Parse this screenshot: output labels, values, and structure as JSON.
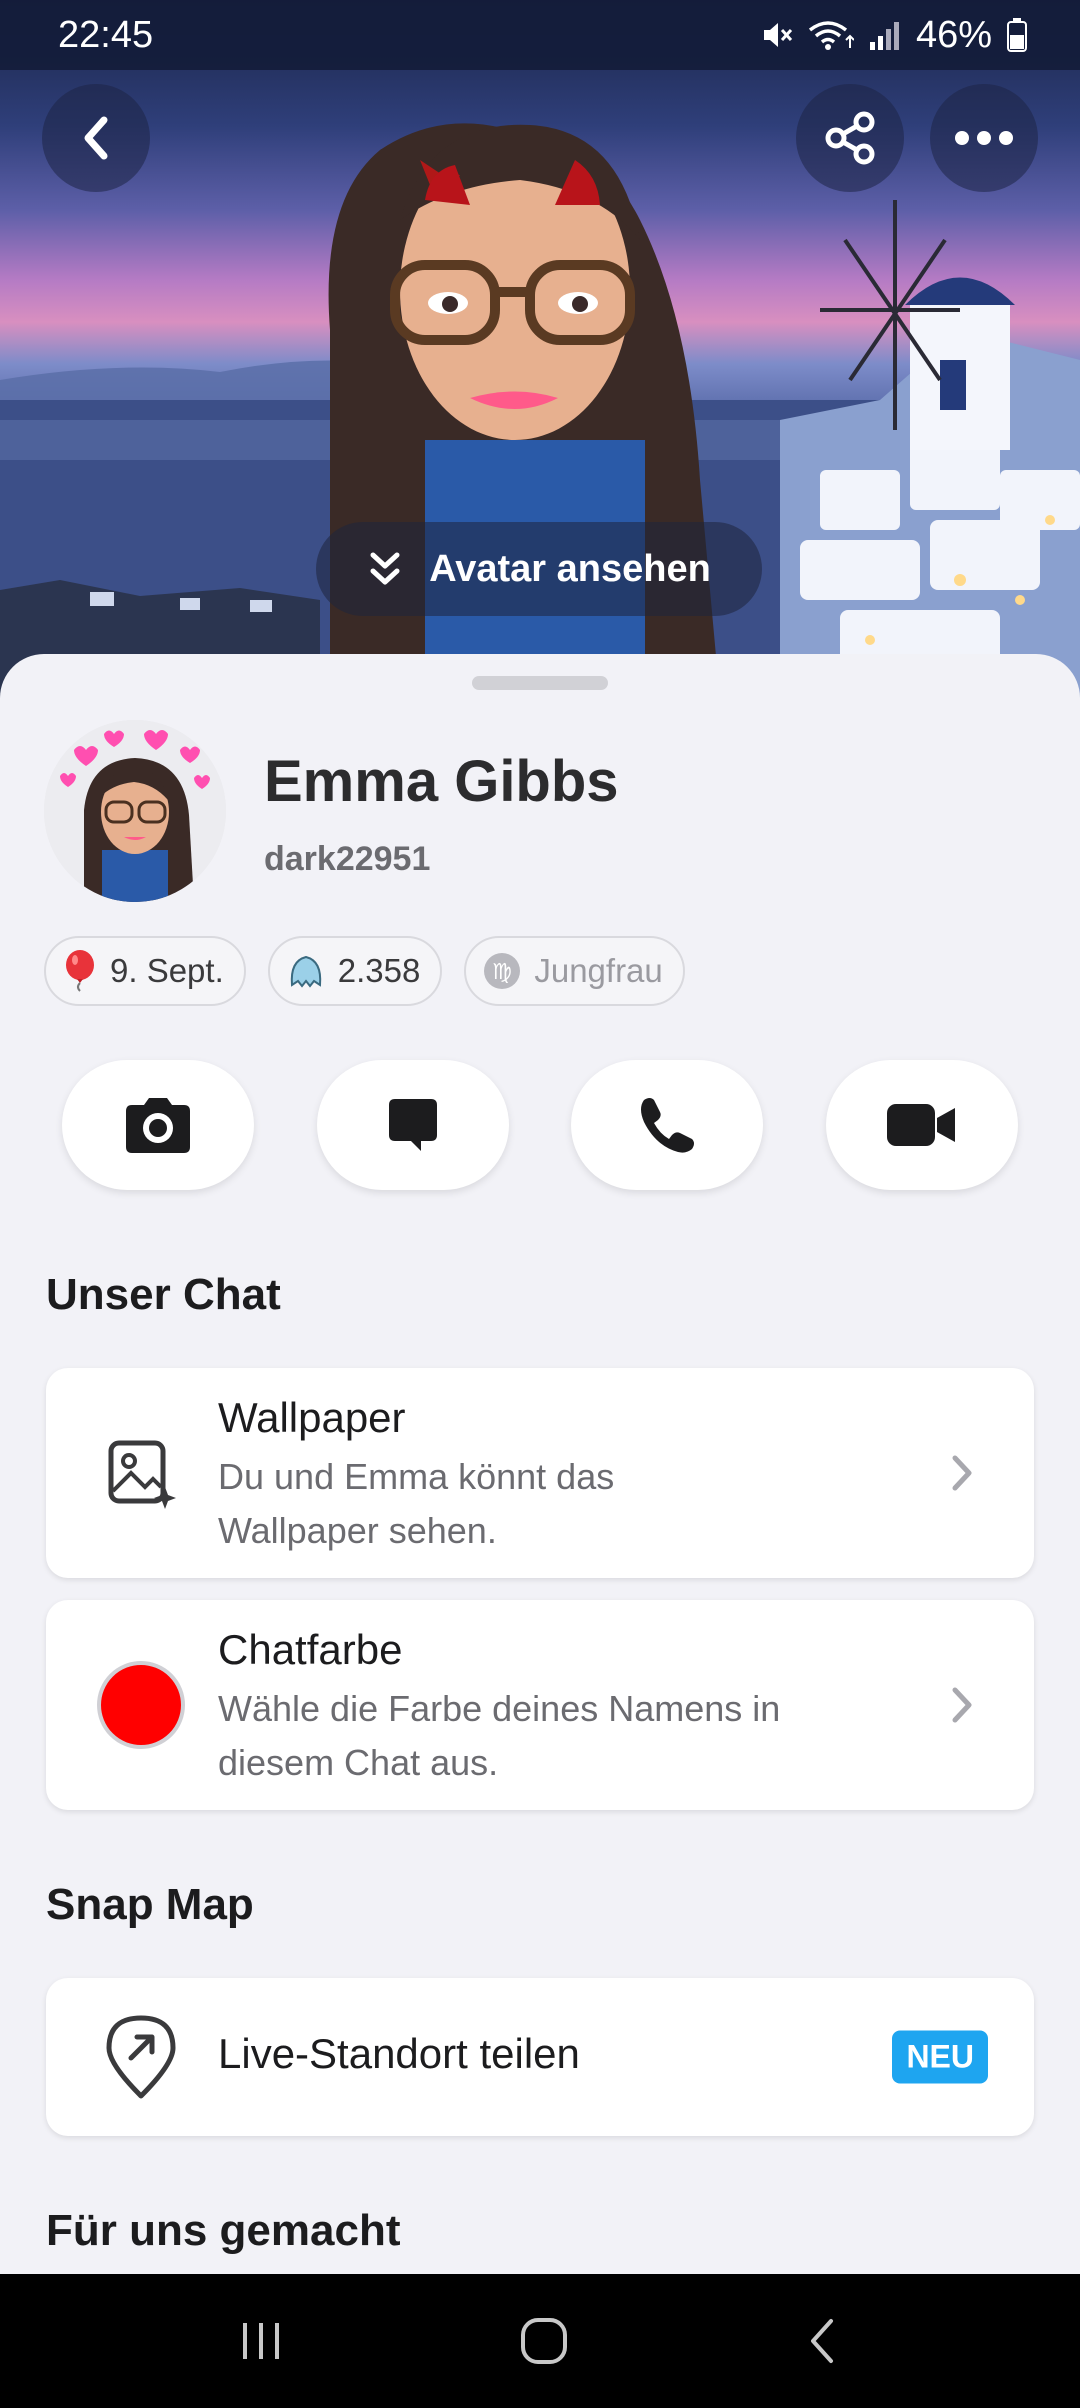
{
  "status_bar": {
    "time": "22:45",
    "battery_percent": "46%",
    "icons": [
      "mute-icon",
      "wifi-icon",
      "signal-icon",
      "battery-icon"
    ]
  },
  "header": {
    "back_icon": "back-chevron-icon",
    "share_icon": "share-icon",
    "more_icon": "more-dots-icon",
    "avatar_button_label": "Avatar ansehen"
  },
  "profile": {
    "name": "Emma Gibbs",
    "username": "dark22951",
    "chips": [
      {
        "icon": "balloon-icon",
        "label": "9. Sept."
      },
      {
        "icon": "ghost-score-icon",
        "label": "2.358"
      },
      {
        "icon": "virgo-icon",
        "label": "Jungfrau"
      }
    ]
  },
  "actions": [
    {
      "icon": "camera-icon",
      "name": "camera"
    },
    {
      "icon": "chat-icon",
      "name": "chat"
    },
    {
      "icon": "phone-icon",
      "name": "call"
    },
    {
      "icon": "video-icon",
      "name": "video-call"
    }
  ],
  "sections": {
    "our_chat": {
      "title": "Unser Chat",
      "wallpaper": {
        "title": "Wallpaper",
        "desc_line1": "Du und Emma könnt das",
        "desc_line2": "Wallpaper sehen."
      },
      "chat_color": {
        "title": "Chatfarbe",
        "desc_line1": "Wähle die Farbe deines Namens in",
        "desc_line2": "diesem Chat aus.",
        "color": "#ff0000"
      }
    },
    "snap_map": {
      "title": "Snap Map",
      "live_location": {
        "title": "Live-Standort teilen",
        "badge": "NEU"
      }
    },
    "made_for_us": {
      "title": "Für uns gemacht"
    }
  },
  "colors": {
    "accent_blue": "#1ea5f0",
    "sheet_background": "#f2f2f7"
  }
}
